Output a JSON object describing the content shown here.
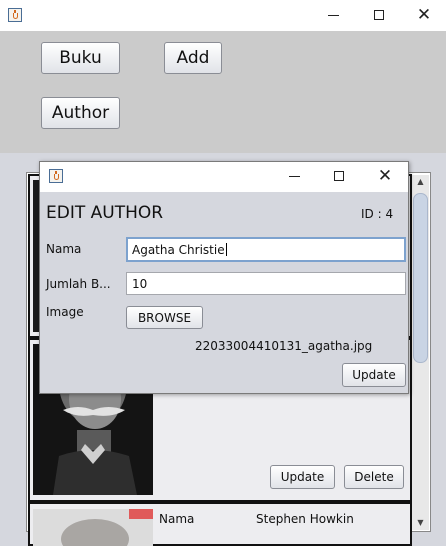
{
  "main_window": {
    "buttons": {
      "buku": "Buku",
      "add": "Add",
      "author": "Author"
    }
  },
  "list": {
    "card_2": {
      "update": "Update",
      "delete": "Delete"
    },
    "card_3": {
      "field_label": "Nama",
      "field_value": "Stephen Howkin"
    }
  },
  "dialog": {
    "heading": "EDIT AUTHOR",
    "id_label": "ID : 4",
    "fields": {
      "nama_label": "Nama",
      "nama_value": "Agatha Christie",
      "jumlah_label": "Jumlah B...",
      "jumlah_value": "10",
      "image_label": "Image"
    },
    "browse_label": "BROWSE",
    "file_name": "22033004410131_agatha.jpg",
    "update_label": "Update"
  },
  "colors": {
    "window_bg": "#d5d7de",
    "toolbar_bg": "#cbcbcb",
    "focus_border": "#7da2ce",
    "titlebar_bg": "#ffffff"
  },
  "icons": {
    "app": "java-coffee-cup-icon",
    "minimize": "minimize-icon",
    "maximize": "maximize-icon",
    "close": "close-icon"
  }
}
